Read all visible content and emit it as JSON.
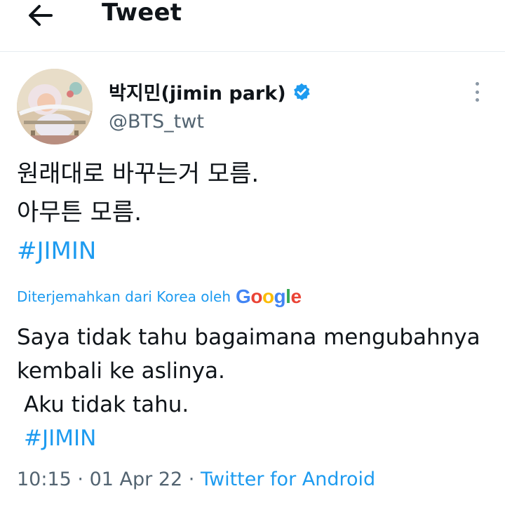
{
  "header": {
    "title": "Tweet",
    "back_icon": "arrow-left-icon"
  },
  "tweet": {
    "author": {
      "display_name": "박지민(jimin park)",
      "handle": "@BTS_twt",
      "verified_icon": "verified-badge-icon"
    },
    "more_icon": "more-vertical-icon",
    "text_lines": [
      "원래대로 바꾸는거 모름.",
      "아무튼 모름."
    ],
    "hashtag": "#JIMIN",
    "translation": {
      "label": "Diterjemahkan dari Korea oleh",
      "provider": "Google",
      "lines": [
        "Saya tidak tahu bagaimana mengubahnya",
        "kembali ke aslinya.",
        "Aku tidak tahu."
      ],
      "hashtag": "#JIMIN"
    },
    "timestamp": {
      "time": "10:15",
      "separator": "·",
      "date": "01 Apr 22",
      "source": "Twitter for Android"
    }
  },
  "colors": {
    "link": "#1d9bf0",
    "secondary_text": "#536471",
    "primary_text": "#0f1419"
  }
}
